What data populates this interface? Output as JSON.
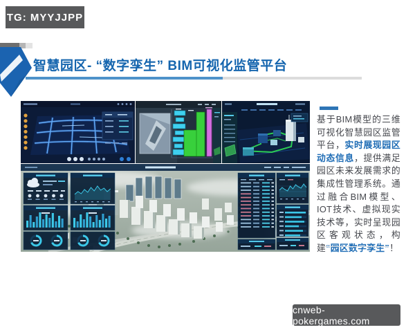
{
  "colors": {
    "title_blue": "#1565ae",
    "accent_blue": "#1e6cb5",
    "body_text": "#45474d",
    "underline_blue": "#4e92ca",
    "underline_gray": "#dcdcdc",
    "badge_bg": "#58595b",
    "badge_fg": "#ffffff",
    "dash_navy": "#0c1b38",
    "dash_cyan": "#3fd0f0",
    "dash_green": "#38d03c",
    "dash_magenta": "#d46fe0",
    "dash_orange": "#e2a23e"
  },
  "badge": {
    "label": "TG: MYYJJPP"
  },
  "header": {
    "title": "智慧园区- “数字孪生” BIM可视化监管平台"
  },
  "sidebar": {
    "paragraph": [
      {
        "text": "基于BIM模型的三维可视化智慧园区监管平台，",
        "bold": false
      },
      {
        "text": "实时展现园区动态信息",
        "bold": true
      },
      {
        "text": "，提供满足园区未来发展需求的集成性管理系统。通过融合BIM模型、IOT技术、虚拟现实技术等，实时呈现园区客观状态，构建",
        "bold": false
      },
      {
        "text": "“园区数字孪生”",
        "bold": true
      },
      {
        "text": "！",
        "bold": false
      }
    ]
  },
  "watermark": {
    "label": "cnweb-pokergames.com"
  },
  "dashboard": {
    "map_panel": {
      "side_dot_count": 7,
      "bottom_icons": {
        "light": 3,
        "small": 4,
        "blue": 2
      }
    },
    "floors_panel": {
      "cyan_blocks": [
        [
          56,
          14,
          16,
          7
        ],
        [
          58,
          24,
          12,
          6
        ],
        [
          54,
          33,
          18,
          7
        ],
        [
          57,
          43,
          13,
          6
        ],
        [
          54,
          52,
          16,
          7
        ],
        [
          56,
          62,
          12,
          6
        ],
        [
          54,
          70,
          18,
          8
        ]
      ],
      "green_blocks": [
        [
          70,
          42,
          20,
          38
        ],
        [
          88,
          16,
          12,
          64
        ]
      ],
      "magenta_blocks": [
        [
          103,
          12,
          7,
          68
        ]
      ]
    },
    "stats": {
      "bars_a": [
        10,
        18,
        8,
        16,
        22,
        12,
        19,
        14,
        21,
        9,
        17,
        13
      ],
      "bars_b": [
        14,
        9,
        19,
        12,
        22,
        16,
        8,
        18,
        11,
        20,
        13,
        17
      ],
      "area_a": [
        8,
        12,
        9,
        15,
        11,
        18,
        13,
        20,
        14,
        17,
        12,
        16
      ],
      "area_b": [
        10,
        14,
        11,
        9,
        16,
        12,
        18,
        15,
        13,
        19,
        14
      ],
      "hbars": [
        30,
        24,
        28,
        20,
        26,
        22
      ],
      "gauge_count": 2,
      "forecast_count": 5,
      "list_row_count": 13
    }
  }
}
